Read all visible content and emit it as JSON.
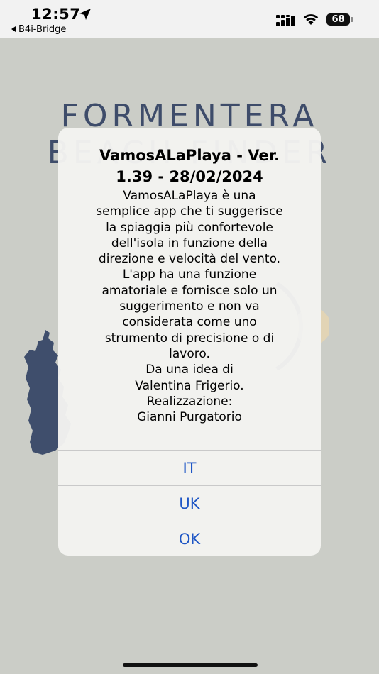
{
  "status_bar": {
    "time": "12:57",
    "back_label": "B4i-Bridge",
    "battery": "68"
  },
  "background": {
    "brand_line1": "FORMENTERA",
    "brand_line2": "BEACH FINDER"
  },
  "alert": {
    "title_lines": [
      "VamosALaPlaya - Ver.",
      "1.39 - 28/02/2024"
    ],
    "message_lines": [
      "VamosALaPlaya è una",
      "semplice app che ti suggerisce",
      "la spiaggia più confortevole",
      "dell'isola in funzione della",
      "direzione e velocità del vento.",
      "L'app ha una funzione",
      "amatoriale e fornisce solo un",
      "suggerimento e non va",
      "considerata come uno",
      "strumento di precisione o di",
      "lavoro.",
      "Da una idea di",
      "Valentina Frigerio.",
      "Realizzazione:",
      "Gianni Purgatorio"
    ],
    "buttons": {
      "it": "IT",
      "uk": "UK",
      "ok": "OK"
    }
  },
  "colors": {
    "accent": "#1e56c5",
    "brand": "#3e4c6a",
    "background": "#cbcdc7"
  },
  "icons": [
    "location-arrow-icon",
    "signal-icon",
    "wifi-icon",
    "battery-icon",
    "back-arrow-icon"
  ]
}
